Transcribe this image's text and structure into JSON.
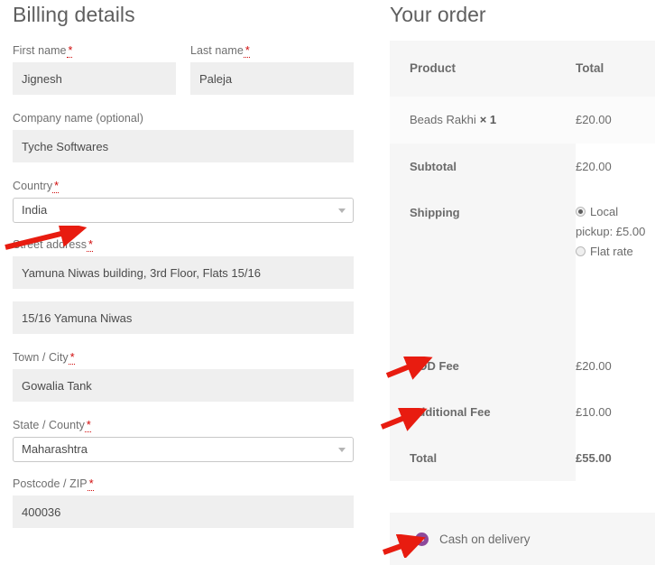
{
  "billing": {
    "heading": "Billing details",
    "fields": [
      {
        "label": "First name",
        "required": true,
        "value": "Jignesh",
        "type": "text"
      },
      {
        "label": "Last name",
        "required": true,
        "value": "Paleja",
        "type": "text"
      },
      {
        "label": "Company name (optional)",
        "required": false,
        "value": "Tyche Softwares",
        "type": "text"
      },
      {
        "label": "Country",
        "required": true,
        "value": "India",
        "type": "select"
      },
      {
        "label": "Street address",
        "required": true,
        "value": "Yamuna Niwas building, 3rd Floor, Flats 15/16",
        "type": "text"
      },
      {
        "label": "",
        "required": false,
        "value": "15/16 Yamuna Niwas",
        "type": "text"
      },
      {
        "label": "Town / City",
        "required": true,
        "value": "Gowalia Tank",
        "type": "text"
      },
      {
        "label": "State / County",
        "required": true,
        "value": "Maharashtra",
        "type": "select"
      },
      {
        "label": "Postcode / ZIP",
        "required": true,
        "value": "400036",
        "type": "text"
      }
    ],
    "required_marker": "*"
  },
  "order": {
    "heading": "Your order",
    "columns": {
      "product": "Product",
      "total": "Total"
    },
    "items": [
      {
        "name": "Beads Rakhi",
        "quantity": "× 1",
        "total": "£20.00"
      }
    ],
    "subtotal": {
      "label": "Subtotal",
      "value": "£20.00"
    },
    "shipping": {
      "label": "Shipping",
      "options": [
        {
          "label": "Local pickup: £5.00",
          "selected": true
        },
        {
          "label": "Flat rate",
          "selected": false
        }
      ]
    },
    "fees": [
      {
        "label": "COD Fee",
        "value": "£20.00"
      },
      {
        "label": "Additional Fee",
        "value": "£10.00"
      }
    ],
    "total": {
      "label": "Total",
      "value": "£55.00"
    }
  },
  "payment": {
    "methods": [
      {
        "label": "Cash on delivery",
        "selected": true,
        "color": "#8d4a9b"
      }
    ]
  },
  "annotations": {
    "arrow_color": "#e81c10",
    "arrows": [
      {
        "name": "arrow-country",
        "target": "Country select"
      },
      {
        "name": "arrow-cod-fee",
        "target": "COD Fee row"
      },
      {
        "name": "arrow-additional-fee",
        "target": "Additional Fee row"
      },
      {
        "name": "arrow-cash-on-delivery",
        "target": "Cash on delivery radio"
      }
    ]
  },
  "theme": {
    "input_bg": "#efefef",
    "panel_bg": "#f6f6f6",
    "panel_bg_light": "#fbfbfb",
    "label_color": "#6f6f6f",
    "required_color": "#d00b0b"
  }
}
